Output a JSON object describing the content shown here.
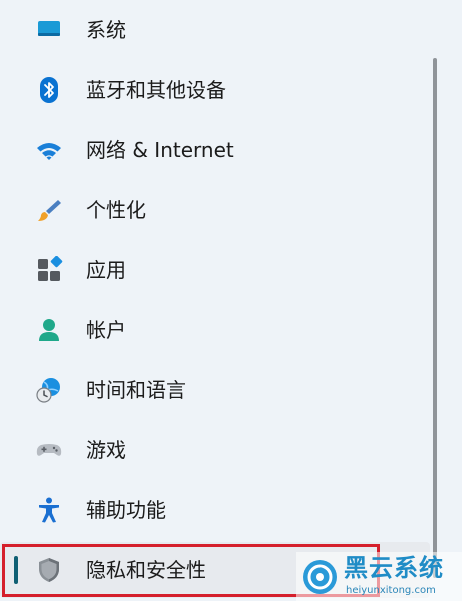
{
  "sidebar": {
    "items": [
      {
        "label": "系统",
        "icon": "system-display-icon"
      },
      {
        "label": "蓝牙和其他设备",
        "icon": "bluetooth-icon"
      },
      {
        "label": "网络 & Internet",
        "icon": "wifi-icon"
      },
      {
        "label": "个性化",
        "icon": "paintbrush-icon"
      },
      {
        "label": "应用",
        "icon": "apps-icon"
      },
      {
        "label": "帐户",
        "icon": "account-icon"
      },
      {
        "label": "时间和语言",
        "icon": "time-language-icon"
      },
      {
        "label": "游戏",
        "icon": "gamepad-icon"
      },
      {
        "label": "辅助功能",
        "icon": "accessibility-icon"
      },
      {
        "label": "隐私和安全性",
        "icon": "shield-icon",
        "selected": true
      }
    ]
  },
  "watermark": {
    "title": "黑云系统",
    "url": "heiyunxitong.com"
  },
  "colors": {
    "background": "#eef3f8",
    "selection_indicator": "#0f5f73",
    "annotation_box": "#d51f2b",
    "accent_blue": "#0078d4"
  }
}
